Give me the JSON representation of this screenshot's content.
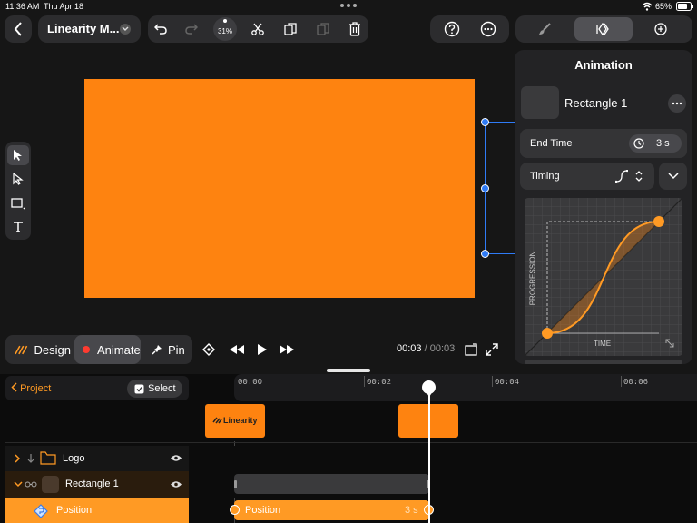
{
  "status_bar": {
    "time": "11:36 AM",
    "date": "Thu Apr 18",
    "battery": "65%"
  },
  "header": {
    "back_icon": "chevron-left-icon",
    "doc_title": "Linearity M...",
    "zoom": "31%"
  },
  "inspector": {
    "title": "Animation",
    "object_name": "Rectangle 1",
    "end_time_label": "End Time",
    "end_time_value": "3 s",
    "timing_label": "Timing",
    "graph_x_label": "TIME",
    "graph_y_label": "PROGRESSION"
  },
  "modes": {
    "design": "Design",
    "animate": "Animate",
    "pin": "Pin"
  },
  "playback": {
    "current": "00:03",
    "separator": " / ",
    "total": "00:03"
  },
  "timeline": {
    "project_label": "Project",
    "select_label": "Select",
    "ticks": [
      "00:00",
      "00:02",
      "00:04",
      "00:06"
    ],
    "logo_clip_text": "Linearity",
    "layers": [
      {
        "name": "Logo"
      },
      {
        "name": "Rectangle 1"
      },
      {
        "name": "Position"
      }
    ],
    "position_track_label": "Position",
    "position_track_duration": "3 s"
  },
  "colors": {
    "accent": "#ff8a14",
    "canvas_bg": "#161616",
    "panel": "#2c2c2e",
    "selection": "#2f7bf6"
  }
}
